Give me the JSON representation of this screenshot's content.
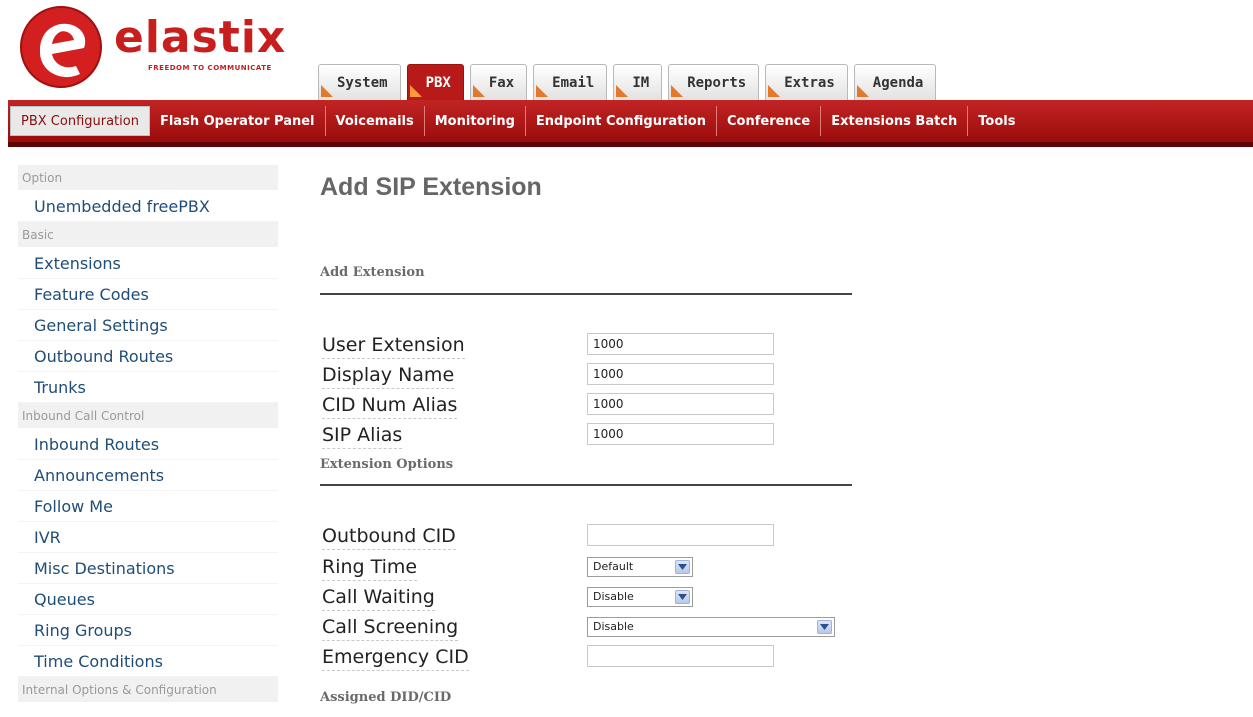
{
  "logo": {
    "brand": "elastix",
    "tagline": "FREEDOM TO COMMUNICATE"
  },
  "top_tabs": [
    "System",
    "PBX",
    "Fax",
    "Email",
    "IM",
    "Reports",
    "Extras",
    "Agenda"
  ],
  "active_top_tab": "PBX",
  "sub_nav": [
    "PBX Configuration",
    "Flash Operator Panel",
    "Voicemails",
    "Monitoring",
    "Endpoint Configuration",
    "Conference",
    "Extensions Batch",
    "Tools"
  ],
  "sidebar": {
    "option_heading": "Option",
    "option_items": [
      "Unembedded freePBX"
    ],
    "basic_heading": "Basic",
    "basic_items": [
      "Extensions",
      "Feature Codes",
      "General Settings",
      "Outbound Routes",
      "Trunks"
    ],
    "inbound_heading": "Inbound Call Control",
    "inbound_items": [
      "Inbound Routes",
      "Announcements",
      "Follow Me",
      "IVR",
      "Misc Destinations",
      "Queues",
      "Ring Groups",
      "Time Conditions"
    ],
    "internal_heading": "Internal Options & Configuration"
  },
  "main": {
    "title": "Add SIP Extension",
    "add_extension_heading": "Add Extension",
    "fields": {
      "user_extension": {
        "label": "User Extension",
        "value": "1000"
      },
      "display_name": {
        "label": "Display Name",
        "value": "1000"
      },
      "cid_num_alias": {
        "label": "CID Num Alias",
        "value": "1000"
      },
      "sip_alias": {
        "label": "SIP Alias",
        "value": "1000"
      }
    },
    "extension_options_heading": "Extension Options",
    "options": {
      "outbound_cid": {
        "label": "Outbound CID",
        "value": ""
      },
      "ring_time": {
        "label": "Ring Time",
        "selected": "Default"
      },
      "call_waiting": {
        "label": "Call Waiting",
        "selected": "Disable"
      },
      "call_screening": {
        "label": "Call Screening",
        "selected": "Disable"
      },
      "emergency_cid": {
        "label": "Emergency CID",
        "value": ""
      }
    },
    "assigned_heading": "Assigned DID/CID"
  },
  "colors": {
    "brand_red": "#c81e1e",
    "nav_red": "#9b0c0c",
    "tab_accent": "#e4782b",
    "link_blue": "#1f4d78"
  }
}
